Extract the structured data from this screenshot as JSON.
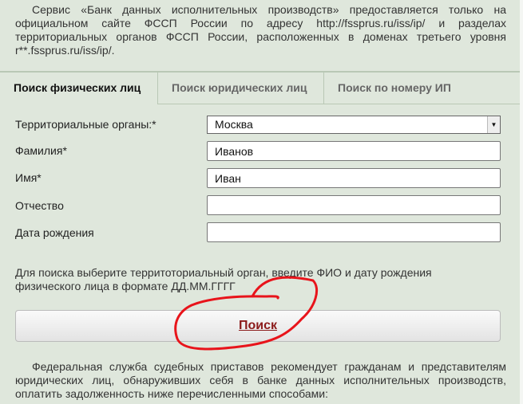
{
  "intro": "Сервис «Банк данных исполнительных производств» предоставляется только на официальном сайте ФССП России по адресу http://fssprus.ru/iss/ip/ и разделах территориальных органов ФССП России, расположенных в доменах третьего уровня r**.fssprus.ru/iss/ip/.",
  "tabs": [
    {
      "label": "Поиск физических лиц",
      "active": true
    },
    {
      "label": "Поиск юридических лиц"
    },
    {
      "label": "Поиск по номеру ИП"
    }
  ],
  "form": {
    "region": {
      "label": "Территориальные органы:*",
      "value": "Москва"
    },
    "last_name": {
      "label": "Фамилия*",
      "value": "Иванов"
    },
    "first_name": {
      "label": "Имя*",
      "value": "Иван"
    },
    "patronymic": {
      "label": "Отчество",
      "value": ""
    },
    "birth_date": {
      "label": "Дата рождения",
      "value": ""
    }
  },
  "hint": "Для поиска выберите территоториальный орган, введите ФИО и дату рождения физического лица в формате ДД.ММ.ГГГГ",
  "search_button": "Поиск",
  "outro": "Федеральная служба судебных приставов рекомендует гражданам и представителям юридических лиц, обнаруживших себя в банке данных исполнительных производств, оплатить задолженность ниже перечисленными способами:",
  "colors": {
    "background": "#dfe7dc",
    "button_text": "#8b1a1a",
    "annotation": "#e8141b"
  }
}
